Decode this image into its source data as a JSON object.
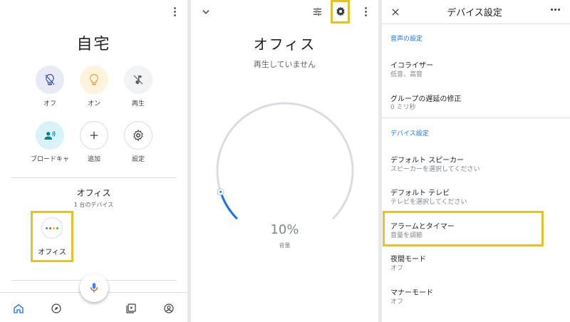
{
  "panel_home": {
    "title": "自宅",
    "quick_actions": [
      {
        "label": "オフ",
        "icon": "bulb-off-icon"
      },
      {
        "label": "オン",
        "icon": "bulb-icon"
      },
      {
        "label": "再生",
        "icon": "music-off-icon"
      },
      {
        "label": "ブロードキャ",
        "icon": "broadcast-icon"
      },
      {
        "label": "追加",
        "icon": "add-icon"
      },
      {
        "label": "設定",
        "icon": "gear-icon"
      }
    ],
    "room": {
      "name": "オフィス",
      "subtitle": "1 台のデバイス"
    },
    "device": {
      "label": "オフィス",
      "icon": "google-home-speaker-icon"
    },
    "bottom_nav": [
      "home-icon",
      "explore-icon",
      "media-icon",
      "account-icon"
    ],
    "fab_icon": "mic-icon"
  },
  "panel_device": {
    "title": "オフィス",
    "status": "再生していません",
    "volume": {
      "value": "10%",
      "label": "音量",
      "level": 0.1
    },
    "header_icons": [
      "chevron-down-icon",
      "equalizer-icon",
      "gear-icon",
      "more-vert-icon"
    ]
  },
  "panel_settings": {
    "title": "デバイス設定",
    "sections": [
      {
        "heading": "音声の設定",
        "items": [
          {
            "title": "イコライザー",
            "subtitle": "低音、高音"
          },
          {
            "title": "グループの遅延の修正",
            "subtitle": "0 ミリ秒"
          }
        ]
      },
      {
        "heading": "デバイス設定",
        "items": [
          {
            "title": "デフォルト スピーカー",
            "subtitle": "スピーカーを選択してください"
          },
          {
            "title": "デフォルト テレビ",
            "subtitle": "テレビを選択してください"
          },
          {
            "title": "アラームとタイマー",
            "subtitle": "音量を調節"
          },
          {
            "title": "夜間モード",
            "subtitle": "オフ"
          },
          {
            "title": "マナーモード",
            "subtitle": "オフ"
          }
        ]
      }
    ]
  },
  "colors": {
    "accent": "#1a73e8",
    "highlight": "#e6c12c"
  }
}
